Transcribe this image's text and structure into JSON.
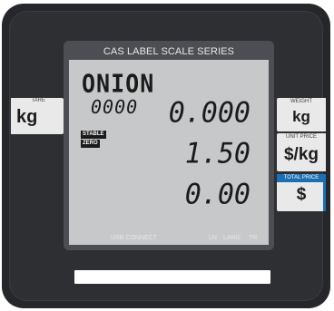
{
  "display": {
    "series_title": "CAS LABEL SCALE SERIES",
    "product_name": "ONION",
    "plu": "0000",
    "weight": "0.000",
    "unit_price": "1.50",
    "total_price": "0.00",
    "flags": {
      "stable": "STABLE",
      "zero": "ZERO"
    },
    "status": {
      "usb": "USB CONNECT",
      "ln": "LN",
      "lang": "LANG",
      "tr": "TR"
    }
  },
  "left_panel": {
    "tag": "TARE",
    "unit": "kg"
  },
  "right_panel": {
    "weight": {
      "tag": "WEIGHT",
      "unit": "kg"
    },
    "unit_price": {
      "tag": "UNIT PRICE",
      "unit": "$/kg"
    },
    "total_price": {
      "tag": "TOTAL PRICE",
      "unit": "$"
    }
  },
  "colors": {
    "body": "#26272a",
    "lcd": "#c7c8ca",
    "frame": "#4c4e54",
    "accent": "#1b6fb3",
    "tab": "#e9e9e9"
  }
}
